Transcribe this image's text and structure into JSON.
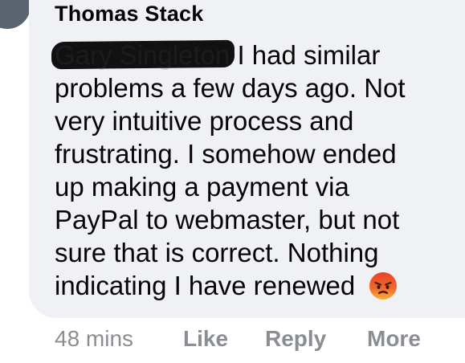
{
  "comment": {
    "author": "Thomas Stack",
    "mention": "Gary Singleton",
    "lines": [
      "I had similar",
      "problems a few days ago. Not",
      "very intuitive process and",
      "frustrating. I somehow ended",
      "up making a payment via",
      "PayPal to webmaster, but not",
      "sure that is correct. Nothing",
      "indicating I have renewed"
    ],
    "reaction_emoji": "angry-face-emoji"
  },
  "actions": {
    "timestamp": "48 mins",
    "like": "Like",
    "reply": "Reply",
    "more": "More"
  }
}
